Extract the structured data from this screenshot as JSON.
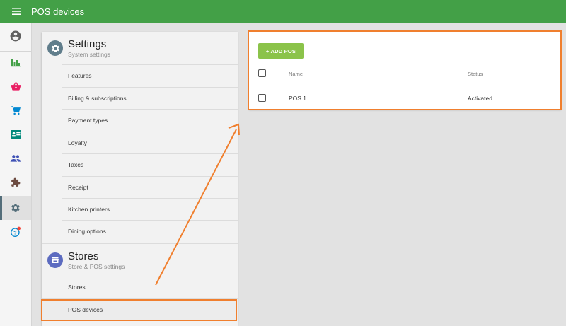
{
  "header": {
    "title": "POS devices",
    "menu_icon": "hamburger-icon",
    "bg_color": "#43a047"
  },
  "left_nav": [
    {
      "icon": "account-circle-icon",
      "color": "#616161"
    },
    {
      "icon": "bar-chart-icon",
      "color": "#43a047"
    },
    {
      "icon": "basket-icon",
      "color": "#e91e63"
    },
    {
      "icon": "cart-icon",
      "color": "#0288d1"
    },
    {
      "icon": "id-card-icon",
      "color": "#00897b"
    },
    {
      "icon": "people-icon",
      "color": "#3f51b5"
    },
    {
      "icon": "puzzle-icon",
      "color": "#6d4c41"
    },
    {
      "icon": "gear-icon",
      "color": "#546e7a",
      "active": true
    },
    {
      "icon": "help-icon",
      "color": "#0288d1",
      "badge_color": "#f44336"
    }
  ],
  "settings": {
    "title": "Settings",
    "subtitle": "System settings",
    "items": [
      {
        "label": "Features"
      },
      {
        "label": "Billing & subscriptions"
      },
      {
        "label": "Payment types"
      },
      {
        "label": "Loyalty"
      },
      {
        "label": "Taxes"
      },
      {
        "label": "Receipt"
      },
      {
        "label": "Kitchen printers"
      },
      {
        "label": "Dining options"
      }
    ]
  },
  "stores": {
    "title": "Stores",
    "subtitle": "Store & POS settings",
    "items": [
      {
        "label": "Stores"
      },
      {
        "label": "POS devices",
        "selected": true
      }
    ]
  },
  "pos_table": {
    "add_button": "+ ADD POS",
    "columns": {
      "name": "Name",
      "status": "Status"
    },
    "rows": [
      {
        "name": "POS 1",
        "status": "Activated"
      }
    ]
  },
  "annotation_color": "#f07f2e"
}
